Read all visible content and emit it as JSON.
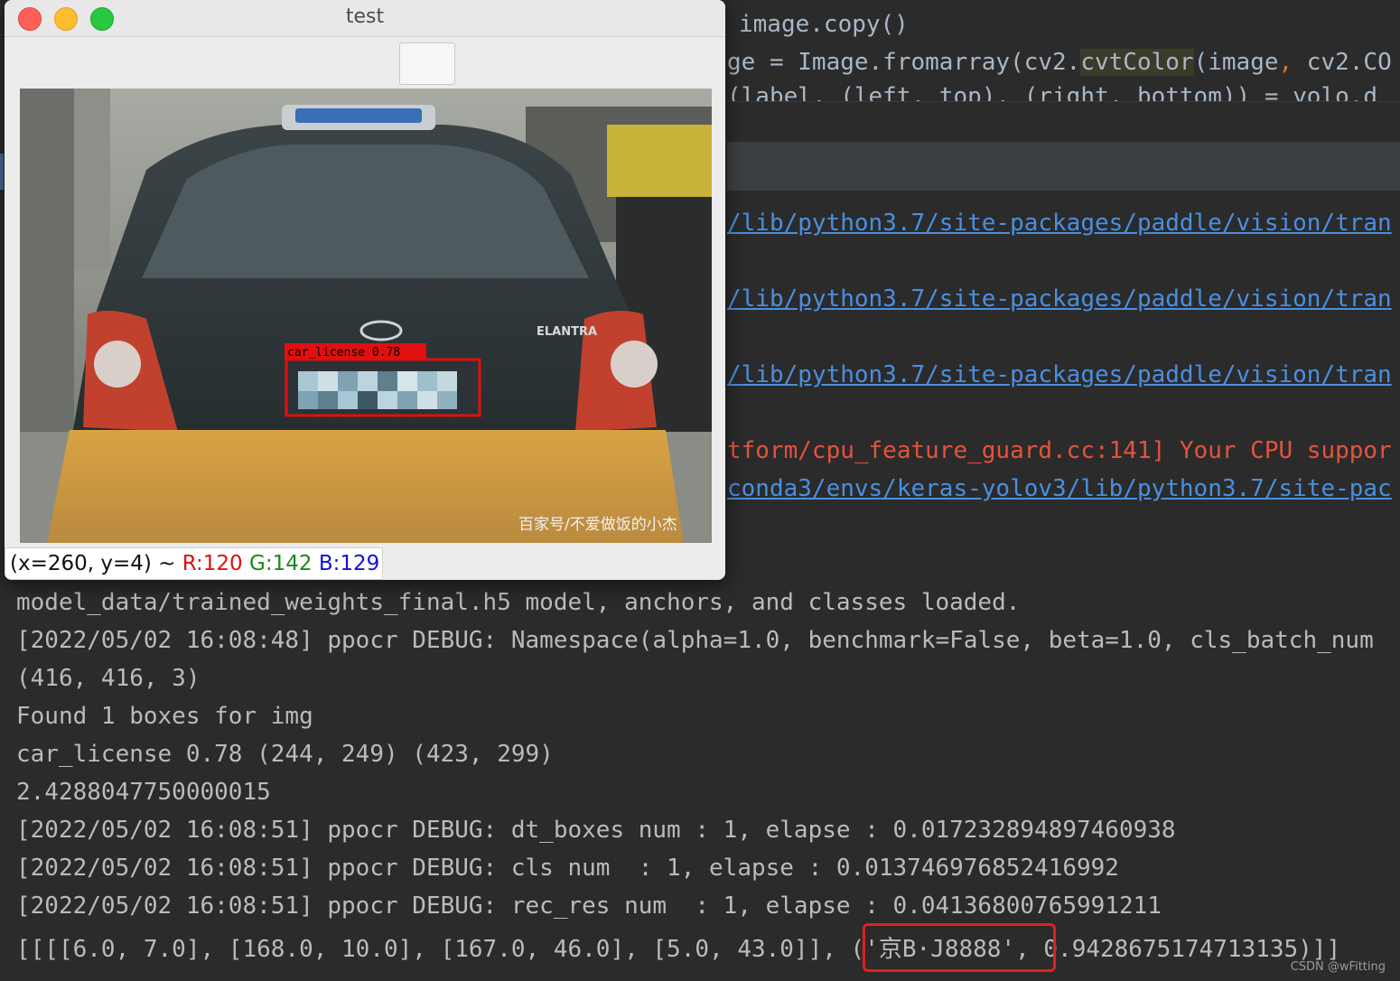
{
  "window": {
    "title": "test",
    "status": {
      "coords": "(x=260, y=4) ~ ",
      "r": "R:120",
      "g": "G:142",
      "b": "B:129"
    },
    "detection": {
      "label": "car_license 0.78",
      "box_color": "#e01010"
    },
    "image_texts": {
      "car_model": "ELANTRA",
      "watermark": "百家号/不爱做饭的小杰"
    }
  },
  "editor": {
    "line1": "image.copy()",
    "line2_a": "ge = Image.fromarray(cv2.",
    "line2_fn": "cvtColor",
    "line2_b": "(image",
    "line2_comma": ",",
    "line2_c": " cv2.CO",
    "line3": "(label, (left, top), (right, bottom)) = yolo.d"
  },
  "console_upper": {
    "link1": "/lib/python3.7/site-packages/paddle/vision/tran",
    "link2": "/lib/python3.7/site-packages/paddle/vision/tran",
    "link3": "/lib/python3.7/site-packages/paddle/vision/tran",
    "warn": "tform/cpu_feature_guard.cc:141] Your CPU suppor",
    "link4": "conda3/envs/keras-yolov3/lib/python3.7/site-pac"
  },
  "console_lines": [
    "model_data/trained_weights_final.h5 model, anchors, and classes loaded.",
    "[2022/05/02 16:08:48] ppocr DEBUG: Namespace(alpha=1.0, benchmark=False, beta=1.0, cls_batch_num",
    "(416, 416, 3)",
    "Found 1 boxes for img",
    "car_license 0.78 (244, 249) (423, 299)",
    "2.4288047750000015",
    "[2022/05/02 16:08:51] ppocr DEBUG: dt_boxes num : 1, elapse : 0.017232894897460938",
    "[2022/05/02 16:08:51] ppocr DEBUG: cls num  : 1, elapse : 0.013746976852416992",
    "[2022/05/02 16:08:51] ppocr DEBUG: rec_res num  : 1, elapse : 0.04136800765991211",
    "[[[[6.0, 7.0], [168.0, 10.0], [167.0, 46.0], [5.0, 43.0]], ('京B·J8888', 0.9428675174713135)]]"
  ],
  "credit": "CSDN @wFitting",
  "colors": {
    "console_bg": "#2b2b2b",
    "console_text": "#bbbbbb",
    "link": "#4a8fe0",
    "error": "#e5533c",
    "highlight_box": "#e02020"
  }
}
